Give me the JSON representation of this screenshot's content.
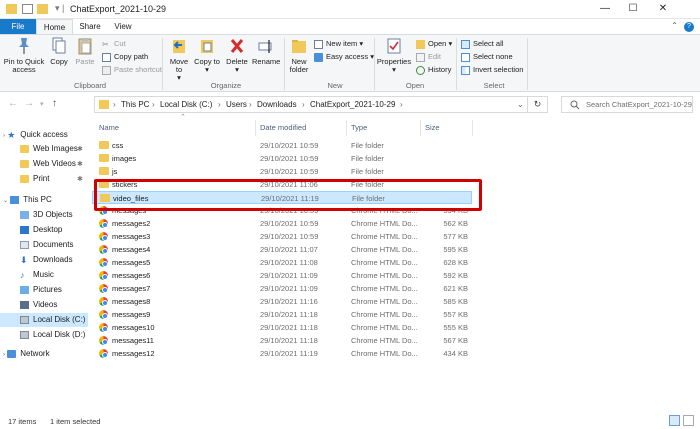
{
  "window": {
    "title": "ChatExport_2021-10-29",
    "minimize": "—",
    "maximize": "☐",
    "close": "✕"
  },
  "tabs": {
    "file": "File",
    "home": "Home",
    "share": "Share",
    "view": "View"
  },
  "ribbon": {
    "clipboard": {
      "label": "Clipboard",
      "pin": "Pin to Quick access",
      "copy": "Copy",
      "paste": "Paste",
      "cut": "Cut",
      "copy_path": "Copy path",
      "paste_shortcut": "Paste shortcut"
    },
    "organize": {
      "label": "Organize",
      "move_to": "Move to",
      "copy_to": "Copy to",
      "delete": "Delete",
      "rename": "Rename"
    },
    "new": {
      "label": "New",
      "new_folder": "New folder",
      "new_item": "New item",
      "easy_access": "Easy access"
    },
    "open": {
      "label": "Open",
      "properties": "Properties",
      "open": "Open",
      "edit": "Edit",
      "history": "History"
    },
    "select": {
      "label": "Select",
      "select_all": "Select all",
      "select_none": "Select none",
      "invert": "Invert selection"
    }
  },
  "address": {
    "crumbs": [
      "This PC",
      "Local Disk (C:)",
      "Users",
      "Downloads",
      "ChatExport_2021-10-29"
    ],
    "search_placeholder": "Search ChatExport_2021-10-29"
  },
  "nav_pane": {
    "quick_access": "Quick access",
    "quick_items": [
      "Web Images",
      "Web Videos",
      "Print"
    ],
    "this_pc": "This PC",
    "pc_items": [
      "3D Objects",
      "Desktop",
      "Documents",
      "Downloads",
      "Music",
      "Pictures",
      "Videos",
      "Local Disk (C:)",
      "Local Disk (D:)"
    ],
    "network": "Network"
  },
  "columns": {
    "name": "Name",
    "date": "Date modified",
    "type": "Type",
    "size": "Size"
  },
  "files": [
    {
      "name": "css",
      "date": "29/10/2021 10:59",
      "type": "File folder",
      "size": "",
      "icon": "folder"
    },
    {
      "name": "images",
      "date": "29/10/2021 10:59",
      "type": "File folder",
      "size": "",
      "icon": "folder"
    },
    {
      "name": "js",
      "date": "29/10/2021 10:59",
      "type": "File folder",
      "size": "",
      "icon": "folder"
    },
    {
      "name": "stickers",
      "date": "29/10/2021 11:06",
      "type": "File folder",
      "size": "",
      "icon": "folder"
    },
    {
      "name": "video_files",
      "date": "29/10/2021 11:19",
      "type": "File folder",
      "size": "",
      "icon": "folder",
      "selected": true
    },
    {
      "name": "messages",
      "date": "29/10/2021 10:59",
      "type": "Chrome HTML Do...",
      "size": "534 KB",
      "icon": "chrome"
    },
    {
      "name": "messages2",
      "date": "29/10/2021 10:59",
      "type": "Chrome HTML Do...",
      "size": "562 KB",
      "icon": "chrome"
    },
    {
      "name": "messages3",
      "date": "29/10/2021 10:59",
      "type": "Chrome HTML Do...",
      "size": "577 KB",
      "icon": "chrome"
    },
    {
      "name": "messages4",
      "date": "29/10/2021 11:07",
      "type": "Chrome HTML Do...",
      "size": "595 KB",
      "icon": "chrome"
    },
    {
      "name": "messages5",
      "date": "29/10/2021 11:08",
      "type": "Chrome HTML Do...",
      "size": "628 KB",
      "icon": "chrome"
    },
    {
      "name": "messages6",
      "date": "29/10/2021 11:09",
      "type": "Chrome HTML Do...",
      "size": "592 KB",
      "icon": "chrome"
    },
    {
      "name": "messages7",
      "date": "29/10/2021 11:09",
      "type": "Chrome HTML Do...",
      "size": "621 KB",
      "icon": "chrome"
    },
    {
      "name": "messages8",
      "date": "29/10/2021 11:16",
      "type": "Chrome HTML Do...",
      "size": "585 KB",
      "icon": "chrome"
    },
    {
      "name": "messages9",
      "date": "29/10/2021 11:18",
      "type": "Chrome HTML Do...",
      "size": "557 KB",
      "icon": "chrome"
    },
    {
      "name": "messages10",
      "date": "29/10/2021 11:18",
      "type": "Chrome HTML Do...",
      "size": "555 KB",
      "icon": "chrome"
    },
    {
      "name": "messages11",
      "date": "29/10/2021 11:18",
      "type": "Chrome HTML Do...",
      "size": "567 KB",
      "icon": "chrome"
    },
    {
      "name": "messages12",
      "date": "29/10/2021 11:19",
      "type": "Chrome HTML Do...",
      "size": "434 KB",
      "icon": "chrome"
    }
  ],
  "status": {
    "items": "17 items",
    "selected": "1 item selected"
  },
  "colors": {
    "accent": "#1979ca",
    "selection": "#cce8ff",
    "highlight_box": "#d00000"
  }
}
